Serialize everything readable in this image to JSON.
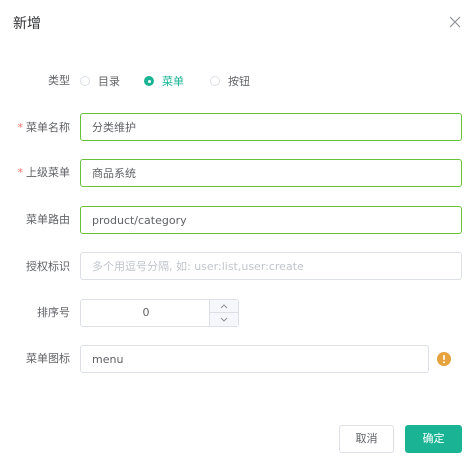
{
  "dialog": {
    "title": "新增"
  },
  "form": {
    "type": {
      "label": "类型",
      "options": [
        {
          "label": "目录",
          "checked": false
        },
        {
          "label": "菜单",
          "checked": true
        },
        {
          "label": "按钮",
          "checked": false
        }
      ]
    },
    "menu_name": {
      "label": "菜单名称",
      "required": "*",
      "value": "分类维护"
    },
    "parent_menu": {
      "label": "上级菜单",
      "required": "*",
      "value": "商品系统"
    },
    "menu_route": {
      "label": "菜单路由",
      "value": "product/category"
    },
    "permission": {
      "label": "授权标识",
      "value": "",
      "placeholder": "多个用逗号分隔, 如: user:list,user:create"
    },
    "order_num": {
      "label": "排序号",
      "value": "0"
    },
    "menu_icon": {
      "label": "菜单图标",
      "value": "menu",
      "hint_icon": "warning-circle-icon"
    }
  },
  "footer": {
    "cancel_label": "取消",
    "confirm_label": "确定"
  },
  "colors": {
    "accent": "#1ab394",
    "valid_border": "#67c23a",
    "required": "#f56c6c",
    "warning": "#e6a23c"
  }
}
